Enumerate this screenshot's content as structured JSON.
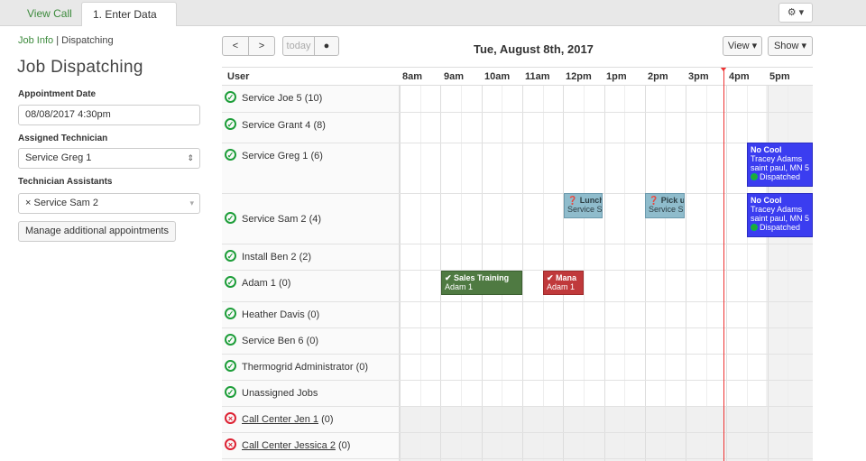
{
  "tabs": {
    "view_call": "View Call",
    "enter_data": "1. Enter Data"
  },
  "settings": {
    "icon": "gear-icon",
    "label": "⚙ ▾"
  },
  "breadcrumb": {
    "job_info": "Job Info",
    "sep": " | ",
    "current": "Dispatching"
  },
  "page_title": "Job Dispatching",
  "form": {
    "appointment_date_label": "Appointment Date",
    "appointment_date_value": "08/08/2017 4:30pm",
    "technician_label": "Assigned Technician",
    "technician_value": "Service Greg 1",
    "assistants_label": "Technician Assistants",
    "assistants_value": "× Service Sam 2",
    "manage_button": "Manage additional appointments"
  },
  "calendar": {
    "prev": "<",
    "next": ">",
    "today": "today",
    "date_title": "Tue, August 8th, 2017",
    "view_label": "View ▾",
    "show_label": "Show ▾",
    "user_header": "User",
    "hours": [
      "8am",
      "9am",
      "10am",
      "11am",
      "12pm",
      "1pm",
      "2pm",
      "3pm",
      "4pm",
      "5pm"
    ],
    "users": [
      {
        "name": "Service Joe 5",
        "count": "(10)",
        "status": "ok",
        "link": false
      },
      {
        "name": "Service Grant 4",
        "count": "(8)",
        "status": "ok",
        "link": false
      },
      {
        "name": "Service Greg 1",
        "count": "(6)",
        "status": "ok",
        "link": false
      },
      {
        "name": "Service Sam 2",
        "count": "(4)",
        "status": "ok",
        "link": false
      },
      {
        "name": "Install Ben 2",
        "count": "(2)",
        "status": "ok",
        "link": false
      },
      {
        "name": "Adam 1",
        "count": "(0)",
        "status": "ok",
        "link": false
      },
      {
        "name": "Heather Davis",
        "count": "(0)",
        "status": "ok",
        "link": false
      },
      {
        "name": "Service Ben 6",
        "count": "(0)",
        "status": "ok",
        "link": false
      },
      {
        "name": "Thermogrid Administrator",
        "count": "(0)",
        "status": "ok",
        "link": false
      },
      {
        "name": "Unassigned Jobs",
        "count": "",
        "status": "ok",
        "link": false
      },
      {
        "name": "Call Center Jen 1",
        "count": "(0)",
        "status": "bad",
        "link": true
      },
      {
        "name": "Call Center Jessica 2",
        "count": "(0)",
        "status": "bad",
        "link": true
      }
    ],
    "events": {
      "greg_nocool": {
        "title": "No Cool",
        "line1": "Tracey Adams",
        "line2": "saint paul, MN 5",
        "status": "Dispatched"
      },
      "sam_lunch": {
        "title": "❓ Lunch",
        "line1": "Service S"
      },
      "sam_pick": {
        "title": "❓ Pick u",
        "line1": "Service S"
      },
      "sam_nocool": {
        "title": "No Cool",
        "line1": "Tracey Adams",
        "line2": "saint paul, MN 5",
        "status": "Dispatched"
      },
      "adam_sales": {
        "title": "✔ Sales Training",
        "line1": "Adam 1"
      },
      "adam_mana": {
        "title": "✔ Mana",
        "line1": "Adam 1"
      }
    }
  }
}
